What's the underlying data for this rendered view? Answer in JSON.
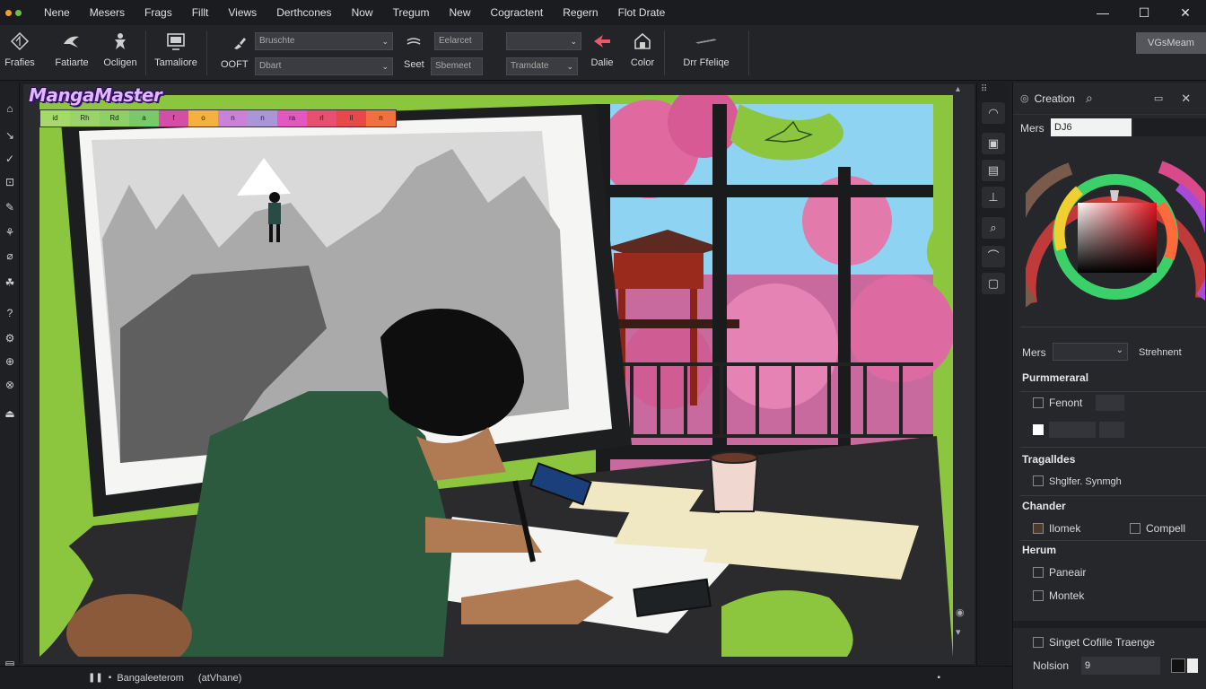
{
  "app": {
    "logo": "MangaMaster"
  },
  "menubar": {
    "items": [
      "Nene",
      "Mesers",
      "Frags",
      "Fillt",
      "Views",
      "Derthcones",
      "Now",
      "Tregum",
      "New",
      "Cogractent",
      "Regern",
      "Flot Drate"
    ],
    "window_controls": [
      "—",
      "☐",
      "✕"
    ]
  },
  "toolbar": {
    "buttons": [
      {
        "label": "Frafies",
        "icon": "compass-icon"
      },
      {
        "label": "Fatiarte",
        "icon": "bird-icon"
      },
      {
        "label": "Ocligen",
        "icon": "figure-icon"
      },
      {
        "label": "Tamaliore",
        "icon": "monitor-icon"
      }
    ],
    "brush_field": {
      "value": "Bruschte"
    },
    "ooft_label": "OOFT",
    "ooft_field": {
      "value": "Dbart"
    },
    "lines_field": {
      "value": "Eelarcet"
    },
    "seet_label": "Seet",
    "seet_field": {
      "value": "Sbemeet"
    },
    "blank_field": {
      "value": ""
    },
    "tram_field": {
      "value": "Tramdate"
    },
    "dalie_label": "Dalie",
    "color_label": "Color",
    "drr_label": "Drr Ffeliqe",
    "pref_box": "VGsMeam"
  },
  "palette": {
    "swatches": [
      {
        "label": "id",
        "color": "#a6d86a"
      },
      {
        "label": "Rh",
        "color": "#9bd36a"
      },
      {
        "label": "Rd",
        "color": "#8fcf6a"
      },
      {
        "label": "a",
        "color": "#79c96a"
      },
      {
        "label": "f",
        "color": "#d44da7"
      },
      {
        "label": "o",
        "color": "#f3b23f"
      },
      {
        "label": "n",
        "color": "#c982d8"
      },
      {
        "label": "n",
        "color": "#a996d8"
      },
      {
        "label": "ra",
        "color": "#e058c0"
      },
      {
        "label": "rl",
        "color": "#e85070"
      },
      {
        "label": "il",
        "color": "#e84848"
      },
      {
        "label": "n",
        "color": "#f07040"
      }
    ]
  },
  "rpanel": {
    "title": "Creation",
    "name_label": "Mers",
    "name_value": "DJ6",
    "mers_label": "Mers",
    "stretch_label": "Strehnent",
    "sections": {
      "pummeraral": "Purmmeraral",
      "tragalides": "Tragalldes",
      "chander": "Chander",
      "heraim": "Herum"
    },
    "fenont": "Fenont",
    "shapes_label": "Shglfer. Synmgh",
    "ilomek": "Ilomek",
    "compell": "Compell",
    "paneair": "Paneair",
    "montek": "Montek",
    "singet": "Singet Cofille Traenge",
    "notion_label": "Nolsion",
    "notion_value": "9"
  },
  "status": {
    "file": "Bangaleeterom",
    "view": "(atVhane)"
  },
  "colors": {
    "accent_green": "#8cc63f",
    "bg_dark": "#1e1f22",
    "panel": "#26272b"
  }
}
